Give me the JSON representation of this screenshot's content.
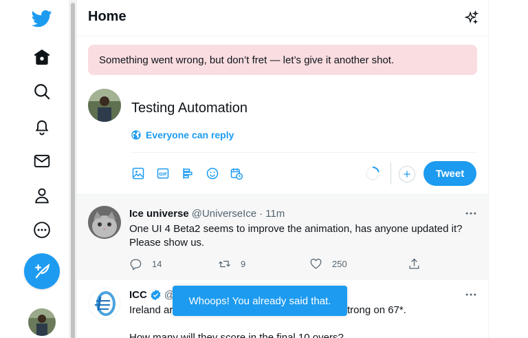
{
  "colors": {
    "accent": "#1d9bf0",
    "error_bg": "#fadde1",
    "text": "#0f1419",
    "muted": "#536471"
  },
  "nav": {
    "items": [
      {
        "name": "twitter-logo",
        "icon": "bird-icon"
      },
      {
        "name": "home",
        "icon": "home-icon"
      },
      {
        "name": "explore",
        "icon": "search-icon"
      },
      {
        "name": "notifications",
        "icon": "bell-icon"
      },
      {
        "name": "messages",
        "icon": "mail-icon"
      },
      {
        "name": "profile",
        "icon": "person-icon"
      },
      {
        "name": "more",
        "icon": "more-circle-icon"
      }
    ],
    "compose_icon": "feather-plus-icon"
  },
  "header": {
    "title": "Home",
    "icon": "sparkle-icon"
  },
  "error_banner": {
    "text": "Something went wrong, but don’t fret — let’s give it another shot."
  },
  "composer": {
    "text": "Testing Automation",
    "reply_setting": "Everyone can reply",
    "tools": [
      "image-icon",
      "gif-icon",
      "poll-icon",
      "emoji-icon",
      "schedule-icon"
    ],
    "tweet_button": "Tweet"
  },
  "tweets": [
    {
      "name": "Ice universe",
      "handle": "@UniverseIce",
      "dot": "·",
      "time": "11m",
      "text": "One UI 4 Beta2 seems to improve the animation, has anyone updated it? Please show us.",
      "replies": "14",
      "retweets": "9",
      "likes": "250"
    },
    {
      "name": "ICC",
      "handle": "@",
      "verified": true,
      "text_line1": "Ireland ar",
      "text_line1_end": "trong on 67*.",
      "text_line2": "How many will they score in the final 10 overs?"
    }
  ],
  "toast": {
    "text": "Whoops! You already said that."
  }
}
